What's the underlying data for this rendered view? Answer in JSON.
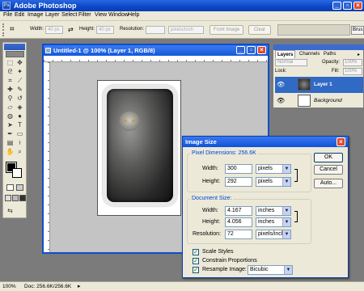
{
  "app": {
    "title": "Adobe Photoshop"
  },
  "menu": [
    "File",
    "Edit",
    "Image",
    "Layer",
    "Select",
    "Filter",
    "View",
    "Window",
    "Help"
  ],
  "options": {
    "width_label": "Width:",
    "width_value": "40 px",
    "height_label": "Height:",
    "height_value": "40 px",
    "resolution_label": "Resolution:",
    "resolution_unit": "pixels/inch",
    "front_image_label": "Front Image",
    "clear_label": "Clear",
    "brush_label": "Brus"
  },
  "document": {
    "title": "Untitled-1 @ 100% (Layer 1, RGB/8)"
  },
  "layers_panel": {
    "tabs": [
      "Layers",
      "Channels",
      "Paths"
    ],
    "blend_mode": "Normal",
    "opacity_label": "Opacity:",
    "opacity_value": "100%",
    "lock_label": "Lock:",
    "fill_label": "Fill:",
    "fill_value": "100%",
    "layers": [
      {
        "name": "Layer 1",
        "selected": true
      },
      {
        "name": "Background",
        "selected": false
      }
    ]
  },
  "dialog": {
    "title": "Image Size",
    "pixel_dimensions_label": "Pixel Dimensions:",
    "pixel_dimensions_value": "256.6K",
    "width_label": "Width:",
    "pixel_width": "300",
    "pixel_width_unit": "pixels",
    "height_label": "Height:",
    "pixel_height": "292",
    "pixel_height_unit": "pixels",
    "document_size_label": "Document Size:",
    "doc_width": "4.167",
    "doc_width_unit": "inches",
    "doc_height": "4.056",
    "doc_height_unit": "inches",
    "resolution_label": "Resolution:",
    "resolution_value": "72",
    "resolution_unit": "pixels/inch",
    "scale_styles": "Scale Styles",
    "constrain_proportions": "Constrain Proportions",
    "resample_image": "Resample Image:",
    "resample_method": "Bicubic",
    "ok_label": "OK",
    "cancel_label": "Cancel",
    "auto_label": "Auto..."
  },
  "status": {
    "zoom": "100%",
    "doc_info": "Doc: 256.6K/256.6K"
  }
}
